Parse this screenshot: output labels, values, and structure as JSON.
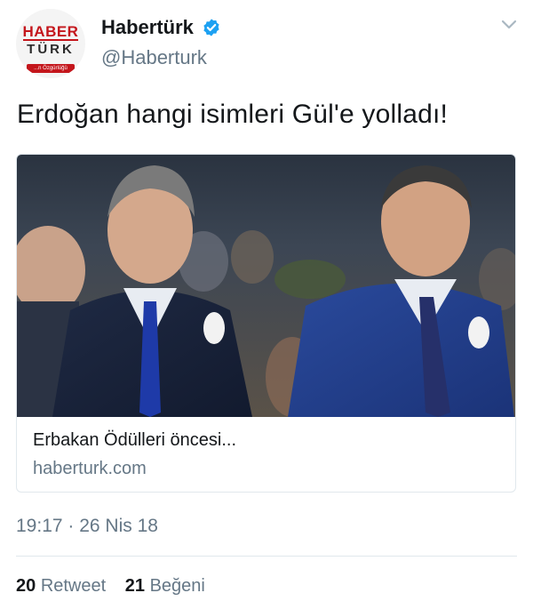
{
  "author": {
    "display_name": "Habertürk",
    "handle": "@Haberturk",
    "verified": true,
    "avatar": {
      "logo_top": "HABER",
      "logo_bottom": "TÜRK",
      "logo_badge": "...n Özgürlüğü"
    }
  },
  "icons": {
    "verified": "verified-badge-icon",
    "menu": "chevron-down-icon"
  },
  "colors": {
    "verified_blue": "#1da1f2",
    "secondary_text": "#657786",
    "brand_red": "#c4161c"
  },
  "tweet": {
    "text": "Erdoğan hangi isimleri Gül'e yolladı!",
    "timestamp": "19:17 · 26 Nis 18"
  },
  "card": {
    "title": "Erbakan Ödülleri öncesi...",
    "domain": "haberturk.com"
  },
  "stats": {
    "retweet_count": "20",
    "retweet_label": "Retweet",
    "like_count": "21",
    "like_label": "Beğeni"
  }
}
